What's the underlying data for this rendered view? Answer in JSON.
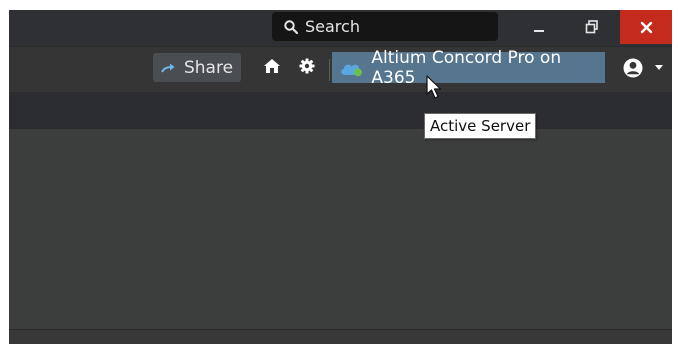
{
  "titlebar": {
    "search_label": "Search",
    "icons": {
      "search": "search-icon",
      "minimize": "minimize-icon",
      "restore": "restore-icon",
      "close": "close-icon"
    }
  },
  "toolbar": {
    "share_label": "Share",
    "server_label": "Altium Concord Pro on A365",
    "icons": {
      "share": "share-arrow-icon",
      "home": "home-icon",
      "settings": "gear-icon",
      "server": "cloud-icon",
      "user": "user-icon",
      "dropdown": "caret-down-icon"
    }
  },
  "tooltip": {
    "text": "Active Server"
  },
  "colors": {
    "close_button": "#c42b1c",
    "server_highlight": "#56768f",
    "share_button": "#4a4e52",
    "cloud_blue": "#5aa8e0",
    "cloud_green": "#6cc04a"
  }
}
